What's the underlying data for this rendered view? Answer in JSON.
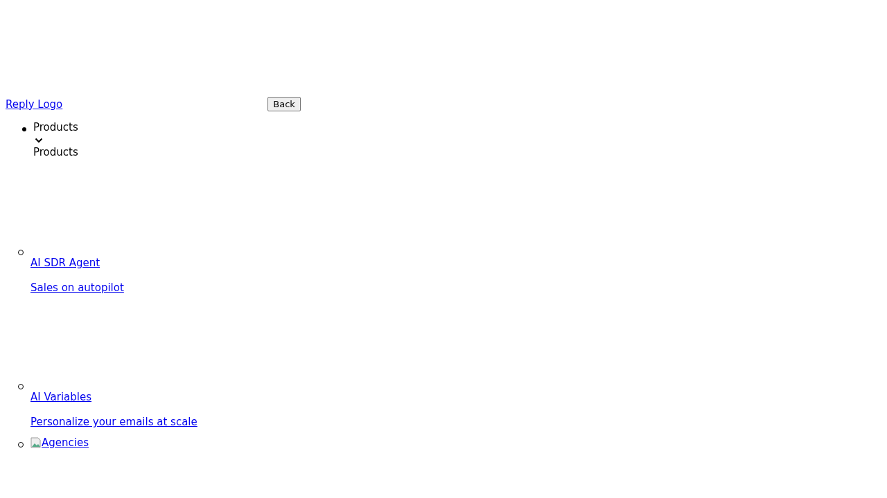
{
  "header": {
    "logo_link": "Reply Logo",
    "back_button": "Back"
  },
  "nav": {
    "menu_item": "Products",
    "expanded": true,
    "submenu_title": "Products",
    "items": [
      {
        "kind": "text",
        "title": "AI SDR Agent",
        "description": "Sales on autopilot"
      },
      {
        "kind": "text",
        "title": "AI Variables",
        "description": "Personalize your emails at scale"
      },
      {
        "kind": "image",
        "title": "Agencies"
      }
    ]
  }
}
